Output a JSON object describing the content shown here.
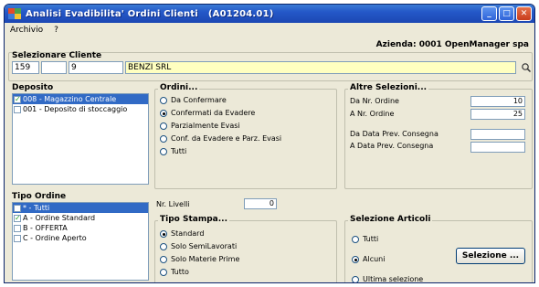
{
  "window": {
    "title": "Analisi Evadibilita' Ordini Clienti   (A01204.01)",
    "buttons": [
      "minimize",
      "maximize",
      "close"
    ]
  },
  "menu": [
    "Archivio",
    "?"
  ],
  "azienda": "Azienda: 0001 OpenManager spa",
  "cliente": {
    "section": "Selezionare Cliente",
    "code": "159",
    "field2": "",
    "field3": "9",
    "name": "BENZI SRL"
  },
  "deposito": {
    "section": "Deposito",
    "items": [
      {
        "label": "008 - Magazzino Centrale",
        "checked": true,
        "selected": true
      },
      {
        "label": "001 - Deposito di stoccaggio",
        "checked": false,
        "selected": false
      }
    ]
  },
  "ordini": {
    "section": "Ordini...",
    "options": [
      {
        "label": "Da Confermare",
        "checked": false
      },
      {
        "label": "Confermati da Evadere",
        "checked": true
      },
      {
        "label": "Parzialmente Evasi",
        "checked": false
      },
      {
        "label": "Conf. da Evadere e Parz. Evasi",
        "checked": false
      },
      {
        "label": "Tutti",
        "checked": false
      }
    ]
  },
  "altre": {
    "section": "Altre Selezioni...",
    "da_nr_label": "Da Nr. Ordine",
    "da_nr_value": "10",
    "a_nr_label": "A  Nr. Ordine",
    "a_nr_value": "25",
    "da_data_label": "Da Data Prev. Consegna",
    "da_data_value": "",
    "a_data_label": "A  Data Prev. Consegna",
    "a_data_value": ""
  },
  "tipo_ordine": {
    "section": "Tipo Ordine",
    "items": [
      {
        "label": "* - Tutti",
        "checked": false,
        "selected": true
      },
      {
        "label": "A - Ordine Standard",
        "checked": true,
        "selected": false
      },
      {
        "label": "B - OFFERTA",
        "checked": false,
        "selected": false
      },
      {
        "label": "C - Ordine Aperto",
        "checked": false,
        "selected": false
      }
    ]
  },
  "livelli": {
    "label": "Nr. Livelli",
    "value": "0"
  },
  "tipo_stampa": {
    "section": "Tipo Stampa...",
    "options": [
      {
        "label": "Standard",
        "checked": true
      },
      {
        "label": "Solo SemiLavorati",
        "checked": false
      },
      {
        "label": "Solo Materie Prime",
        "checked": false
      },
      {
        "label": "Tutto",
        "checked": false
      }
    ]
  },
  "articoli": {
    "section": "Selezione Articoli",
    "options": [
      {
        "label": "Tutti",
        "checked": false
      },
      {
        "label": "Alcuni",
        "checked": true
      },
      {
        "label": "Ultima selezione",
        "checked": false
      }
    ],
    "button": "Selezione ..."
  }
}
